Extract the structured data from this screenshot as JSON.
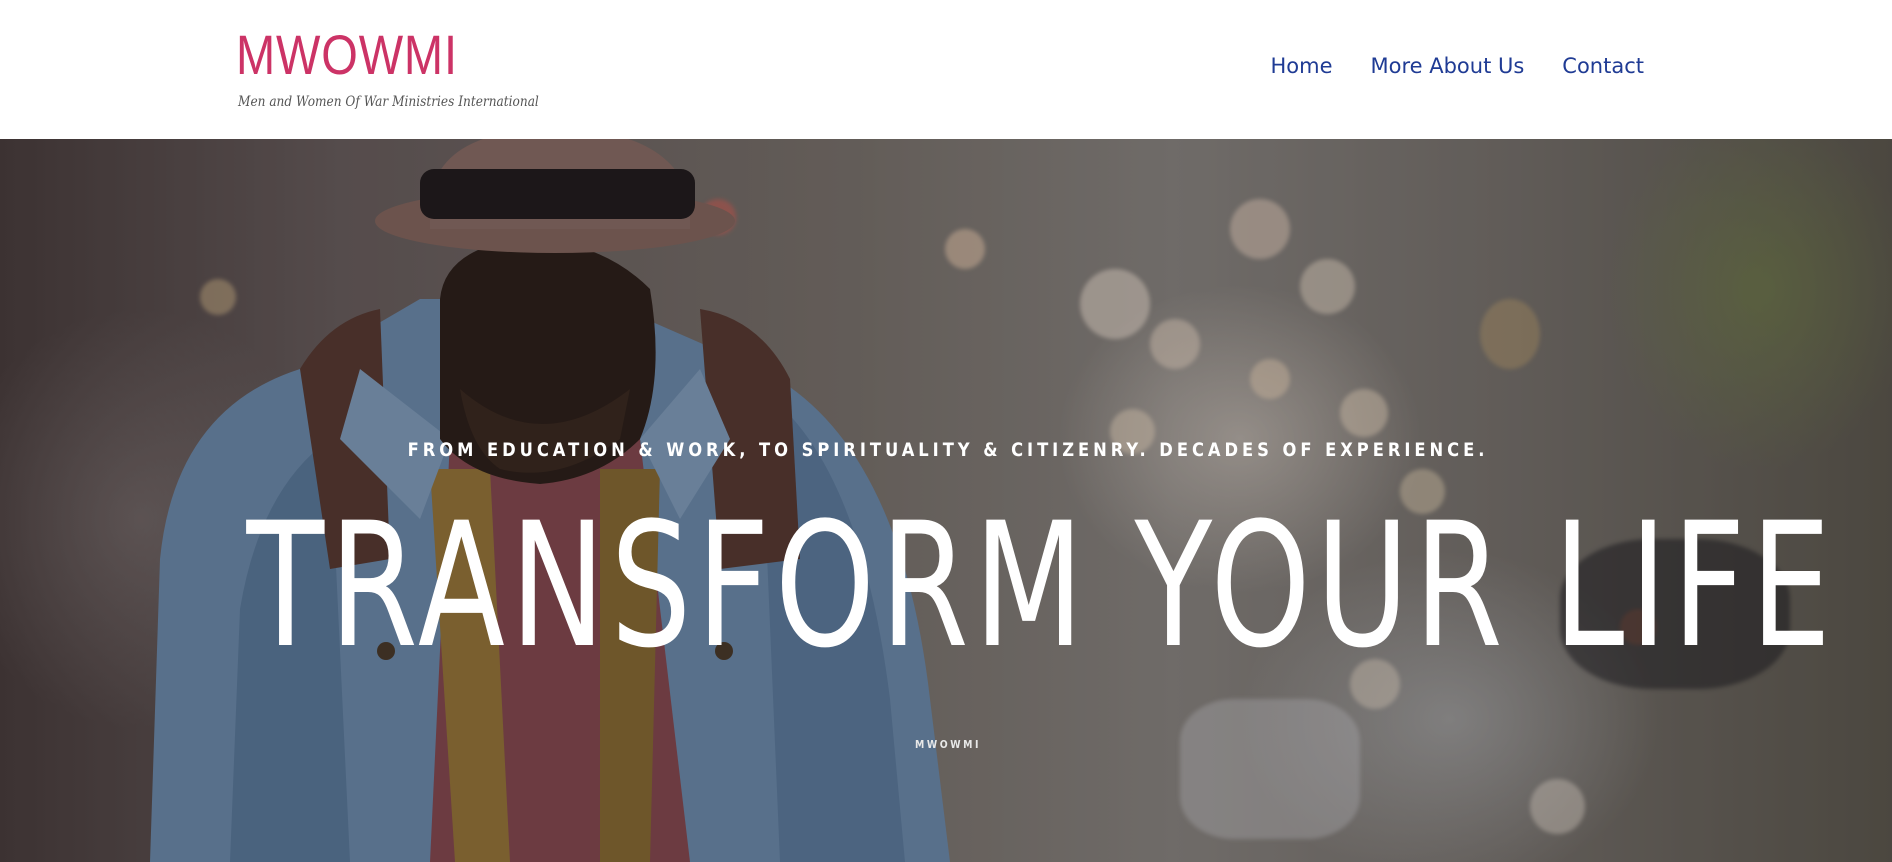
{
  "header": {
    "logo_title": "MWOWMI",
    "logo_tagline": "Men and Women Of War Ministries International",
    "nav": [
      {
        "label": "Home"
      },
      {
        "label": "More About Us"
      },
      {
        "label": "Contact"
      }
    ]
  },
  "hero": {
    "subtitle": "FROM EDUCATION & WORK, TO SPIRITUALITY & CITIZENRY. DECADES OF EXPERIENCE.",
    "title": "TRANSFORM YOUR LIFE",
    "caption": "MWOWMI",
    "background_image": "man-with-hat-and-denim-jacket-on-city-street"
  },
  "colors": {
    "logo": "#cc3366",
    "nav_link": "#1f3b94",
    "hero_text": "#ffffff"
  }
}
